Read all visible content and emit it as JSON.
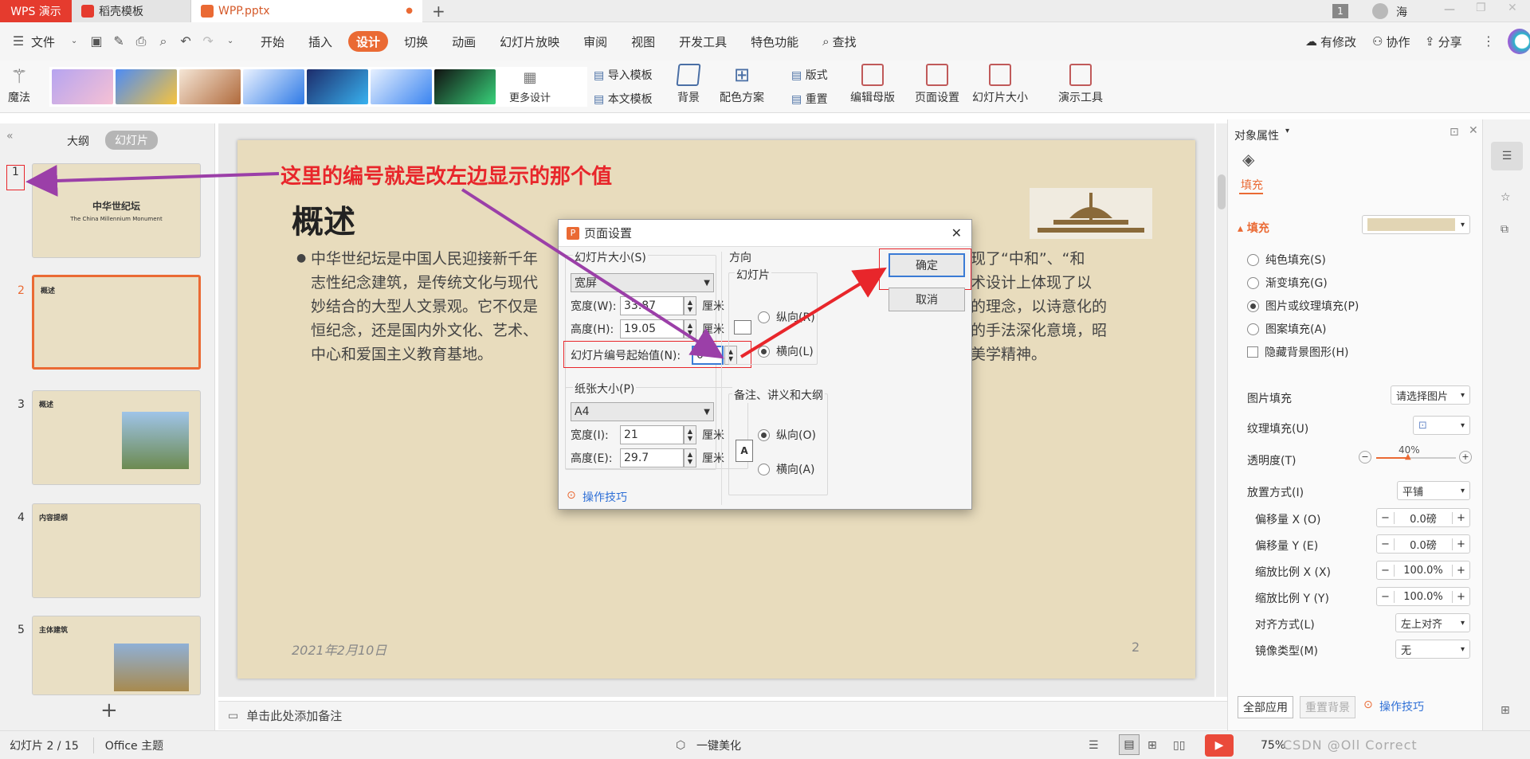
{
  "titlebar": {
    "app_tab": "WPS 演示",
    "template_tab": "稻壳模板",
    "file_tab": "WPP.pptx",
    "add_tab": "+",
    "page_badge": "1",
    "user_name": "海"
  },
  "menubar": {
    "file": "文件",
    "items": [
      "开始",
      "插入",
      "设计",
      "切换",
      "动画",
      "幻灯片放映",
      "审阅",
      "视图",
      "开发工具",
      "特色功能"
    ],
    "search": "查找",
    "modified": "有修改",
    "collab": "协作",
    "share": "分享"
  },
  "ribbon": {
    "magic": "魔法",
    "more_design": "更多设计",
    "import_template": "导入模板",
    "text_template": "本文模板",
    "background": "背景",
    "color_scheme": "配色方案",
    "layout": "版式",
    "reset": "重置",
    "edit_master": "编辑母版",
    "page_setup": "页面设置",
    "slide_size": "幻灯片大小",
    "presentation_tools": "演示工具"
  },
  "leftpanel": {
    "outline_tab": "大纲",
    "slides_tab": "幻灯片",
    "slides": [
      {
        "num": "1",
        "title": "中华世纪坛",
        "subtitle": "The China Millennium Monument"
      },
      {
        "num": "2",
        "title": "概述"
      },
      {
        "num": "3",
        "title": "概述"
      },
      {
        "num": "4",
        "title": "内容提纲"
      },
      {
        "num": "5",
        "title": "主体建筑"
      }
    ],
    "add": "+"
  },
  "slide": {
    "title": "概述",
    "body_left": "中华世纪坛是中国人民迎接新千年\n志性纪念建筑，是传统文化与现代\n妙结合的大型人文景观。它不仅是\n恒纪念，还是国内外文化、艺术、\n中心和爱国主义教育基地。",
    "body_right": "现了“中和”、“和\n术设计上体现了以\n的理念，以诗意化的\n的手法深化意境，昭\n美学精神。",
    "date": "2021年2月10日",
    "page_num": "2"
  },
  "annotation": {
    "text": "这里的编号就是改左边显示的那个值"
  },
  "dialog": {
    "title": "页面设置",
    "slide_size_label": "幻灯片大小(S)",
    "slide_size_value": "宽屏",
    "width_label": "宽度(W):",
    "width_value": "33.87",
    "height_label": "高度(H):",
    "height_value": "19.05",
    "unit": "厘米",
    "start_num_label": "幻灯片编号起始值(N):",
    "start_num_value": "0",
    "paper_label": "纸张大小(P)",
    "paper_value": "A4",
    "paper_width_label": "宽度(I):",
    "paper_width_value": "21",
    "paper_height_label": "高度(E):",
    "paper_height_value": "29.7",
    "orientation_label": "方向",
    "slide_group": "幻灯片",
    "portrait": "纵向(R)",
    "landscape": "横向(L)",
    "notes_group": "备注、讲义和大纲",
    "notes_portrait": "纵向(O)",
    "notes_landscape": "横向(A)",
    "ok": "确定",
    "cancel": "取消",
    "tips": "操作技巧"
  },
  "rightpanel": {
    "title": "对象属性",
    "fill_tab": "填充",
    "fill_section": "填充",
    "options": [
      "纯色填充(S)",
      "渐变填充(G)",
      "图片或纹理填充(P)",
      "图案填充(A)"
    ],
    "hide_bg": "隐藏背景图形(H)",
    "picture_fill_label": "图片填充",
    "picture_fill_value": "请选择图片",
    "texture_fill_label": "纹理填充(U)",
    "transparency_label": "透明度(T)",
    "transparency_value": "40%",
    "transparency_level": 0.4,
    "placement_label": "放置方式(I)",
    "placement_value": "平铺",
    "offset_x_label": "偏移量 X (O)",
    "offset_x_value": "0.0磅",
    "offset_y_label": "偏移量 Y (E)",
    "offset_y_value": "0.0磅",
    "scale_x_label": "缩放比例 X (X)",
    "scale_x_value": "100.0%",
    "scale_y_label": "缩放比例 Y (Y)",
    "scale_y_value": "100.0%",
    "align_label": "对齐方式(L)",
    "align_value": "左上对齐",
    "mirror_label": "镜像类型(M)",
    "mirror_value": "无",
    "apply_all": "全部应用",
    "reset_bg": "重置背景",
    "tips": "操作技巧"
  },
  "notes": {
    "placeholder": "单击此处添加备注"
  },
  "statusbar": {
    "slide_info": "幻灯片 2 / 15",
    "theme": "Office 主题",
    "beautify": "一键美化",
    "zoom": "75%",
    "watermark": "CSDN @Oll Correct"
  },
  "colors": {
    "accent": "#ea6a34",
    "annotation_red": "#e8262b",
    "arrow_purple": "#9b3fa8",
    "slide_bg": "#e8dcbd"
  }
}
